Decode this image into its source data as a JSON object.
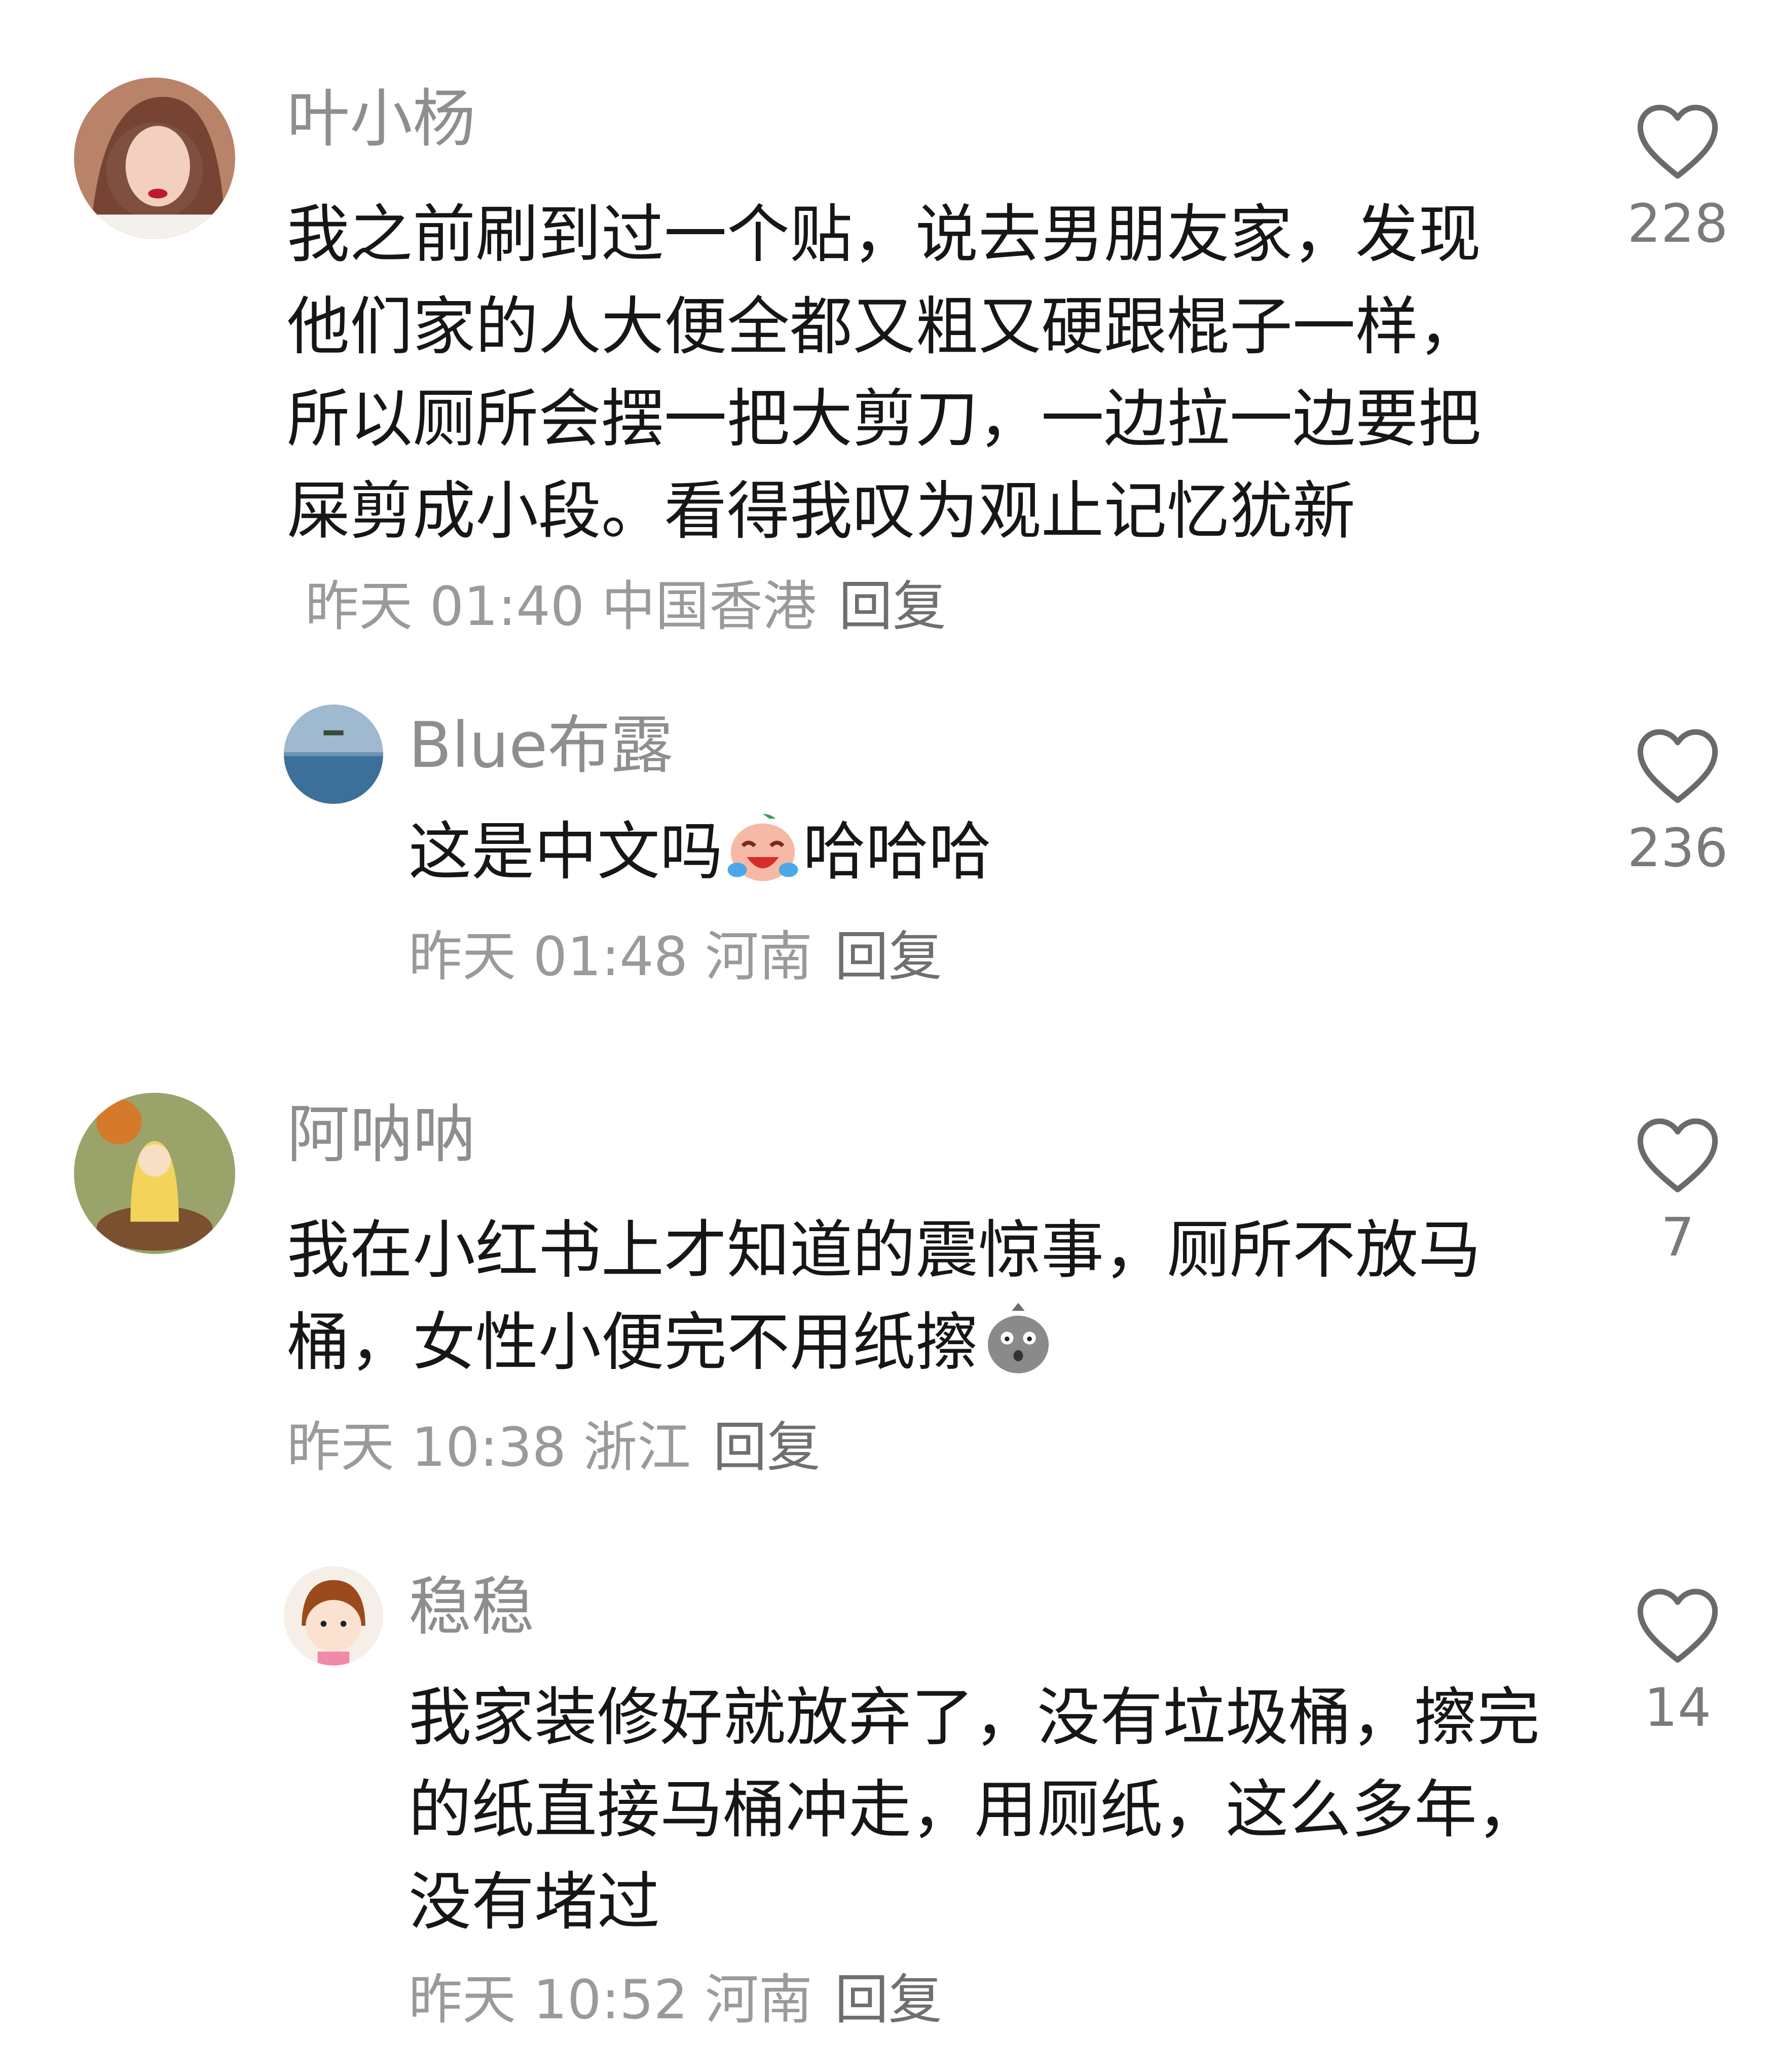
{
  "comments": [
    {
      "username": "叶小杨",
      "text": "我之前刷到过一个贴，说去男朋友家，发现他们家的人大便全都又粗又硬跟棍子一样，所以厕所会摆一把大剪刀，一边拉一边要把屎剪成小段。看得我叹为观止记忆犹新",
      "meta": "昨天 01:40 中国香港",
      "reply": "回复",
      "likes": "228",
      "avatar_icon": "avatar-woman-photo"
    },
    {
      "username": "Blue布露",
      "text": "这是中文吗",
      "emoji": "crying-laughing-emoji",
      "text_after": "哈哈哈",
      "meta": "昨天 01:48 河南",
      "reply": "回复",
      "likes": "236",
      "avatar_icon": "avatar-sea-photo"
    },
    {
      "username": "阿呐呐",
      "text": "我在小红书上才知道的震惊事，厕所不放马桶，女性小便完不用纸擦",
      "emoji": "shocked-face-emoji",
      "meta": "昨天 10:38 浙江",
      "reply": "回复",
      "likes": "7",
      "avatar_icon": "avatar-cartoon-girl"
    },
    {
      "username": "稳稳",
      "text": "我家装修好就放弃了，没有垃圾桶，擦完的纸直接马桶冲走，用厕纸，这么多年，没有堵过",
      "meta": "昨天 10:52 河南",
      "reply": "回复",
      "likes": "14",
      "avatar_icon": "avatar-cartoon-kid"
    }
  ],
  "icons": {
    "like": "heart-outline-icon"
  },
  "colors": {
    "username": "#8e8e8e",
    "body": "#161616",
    "meta": "#9a9a9a",
    "icon": "#6a6a6a"
  }
}
